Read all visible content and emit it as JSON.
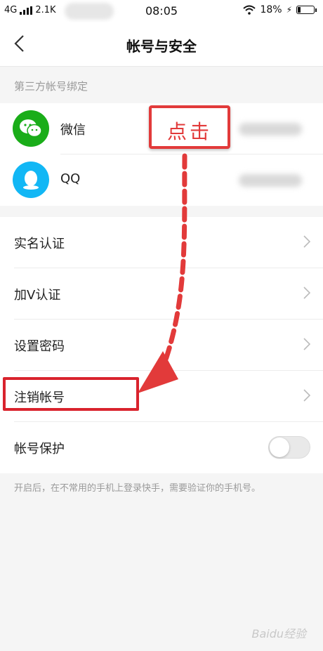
{
  "status_bar": {
    "network": "4G",
    "speed": "2.1K",
    "time": "08:05",
    "battery_text": "18%",
    "battery_level": 0.18
  },
  "navbar": {
    "title": "帐号与安全"
  },
  "third_party": {
    "section_label": "第三方帐号绑定",
    "accounts": [
      {
        "name": "微信",
        "icon": "wechat-icon",
        "color": "#1aad19"
      },
      {
        "name": "QQ",
        "icon": "qq-icon",
        "color": "#12b7f5"
      }
    ]
  },
  "settings": {
    "items": [
      {
        "label": "实名认证"
      },
      {
        "label": "加V认证"
      },
      {
        "label": "设置密码"
      },
      {
        "label": "注销帐号"
      }
    ],
    "protection": {
      "label": "帐号保护",
      "enabled": false
    }
  },
  "footnote": "开启后，在不常用的手机上登录快手，需要验证你的手机号。",
  "annotation": {
    "callout_text": "点击",
    "accent": "#e23a3a"
  },
  "watermark": "Baidu经验"
}
